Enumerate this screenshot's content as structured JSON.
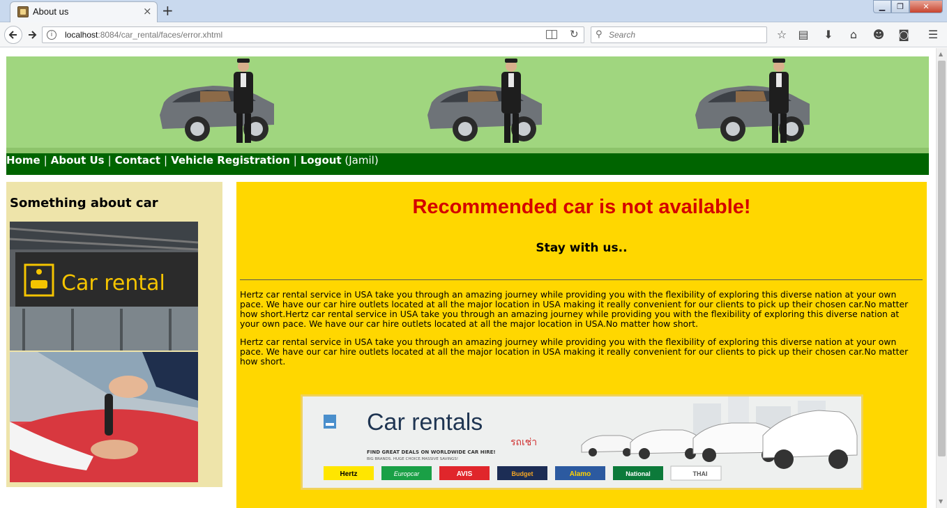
{
  "browser": {
    "tab_title": "About us",
    "tab_close": "×",
    "new_tab": "+",
    "url_host": "localhost",
    "url_rest": ":8084/car_rental/faces/error.xhtml",
    "search_placeholder": "Search",
    "window_min": "▁",
    "window_max": "❐",
    "window_close": "✕",
    "toolbar_icons": [
      "star-icon",
      "reading-list-icon",
      "download-icon",
      "home-icon",
      "smiley-icon",
      "pocket-icon",
      "menu-icon"
    ]
  },
  "nav": {
    "items": [
      "Home",
      "About Us",
      "Contact",
      "Vehicle Registration",
      "Logout"
    ],
    "separator": "|",
    "user": "(Jamil)"
  },
  "sidebar": {
    "title": "Something about car",
    "image1_text": "Car rental"
  },
  "main": {
    "heading": "Recommended car is not available!",
    "subheading": "Stay with us..",
    "paragraph1": "Hertz car rental service in USA take you through an amazing journey while providing you with the flexibility of exploring this diverse nation at your own pace. We have our car hire outlets located at all the major location in USA making it really convenient for our clients to pick up their chosen car.No matter how short.Hertz car rental service in USA take you through an amazing journey while providing you with the flexibility of exploring this diverse nation at your own pace. We have our car hire outlets located at all the major location in USA.No matter how short.",
    "paragraph2": "Hertz car rental service in USA take you through an amazing journey while providing you with the flexibility of exploring this diverse nation at your own pace. We have our car hire outlets located at all the major location in USA making it really convenient for our clients to pick up their chosen car.No matter how short.",
    "ad": {
      "title": "Car rentals",
      "thai": "รถเช่า",
      "tagline": "FIND GREAT DEALS ON WORLDWIDE CAR HIRE!",
      "sub_tagline": "BIG BRANDS. HUGE CHOICE.MASSIVE SAVINGS!",
      "brands": [
        "Hertz",
        "Europcar",
        "AVIS",
        "Budget",
        "Alamo",
        "National",
        "THAI"
      ]
    }
  },
  "colors": {
    "banner": "#a0d67f",
    "menu_bar": "#006400",
    "sidebar": "#eee4aa",
    "main": "#ffd700",
    "heading": "#d40000"
  }
}
